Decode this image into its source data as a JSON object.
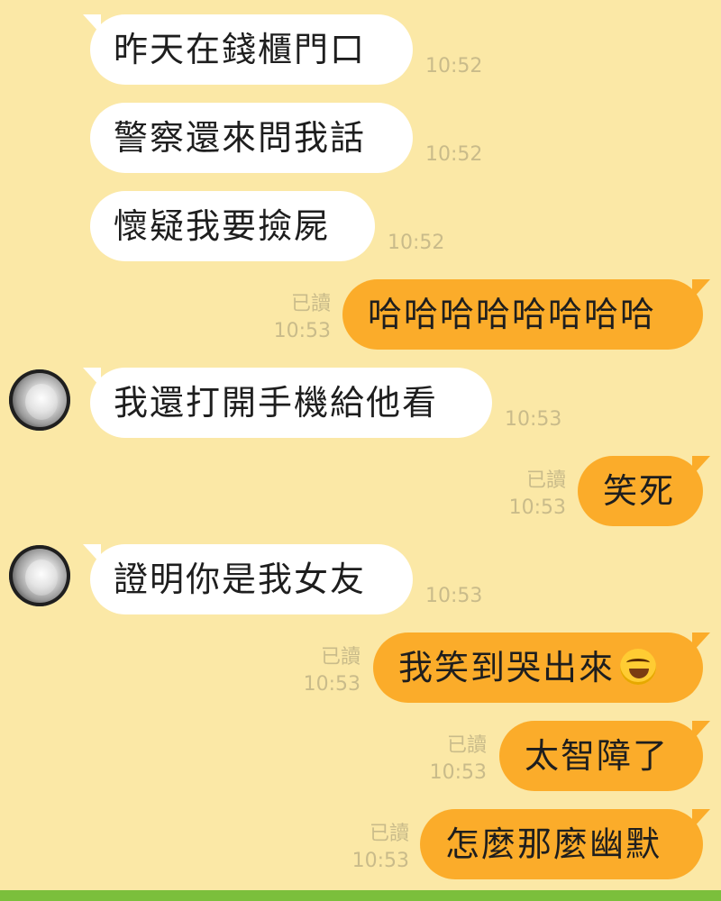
{
  "read_label": "已讀",
  "colors": {
    "background": "#fbe8a6",
    "incoming_bubble": "#ffffff",
    "outgoing_bubble": "#fbac2a",
    "bottom_bar": "#7bbf3c"
  },
  "messages": [
    {
      "side": "incoming",
      "text": "昨天在錢櫃門口",
      "time": "10:52"
    },
    {
      "side": "incoming",
      "text": "警察還來問我話",
      "time": "10:52"
    },
    {
      "side": "incoming",
      "text": "懷疑我要撿屍",
      "time": "10:52"
    },
    {
      "side": "outgoing",
      "text": "哈哈哈哈哈哈哈哈",
      "read": "已讀",
      "time": "10:53"
    },
    {
      "side": "incoming",
      "text": "我還打開手機給他看",
      "time": "10:53",
      "avatar": true
    },
    {
      "side": "outgoing",
      "text": "笑死",
      "read": "已讀",
      "time": "10:53"
    },
    {
      "side": "incoming",
      "text": "證明你是我女友",
      "time": "10:53",
      "avatar": true
    },
    {
      "side": "outgoing",
      "text": "我笑到哭出來",
      "read": "已讀",
      "time": "10:53",
      "emoji": "rolling-on-floor-laughing-emoji"
    },
    {
      "side": "outgoing",
      "text": "太智障了",
      "read": "已讀",
      "time": "10:53"
    },
    {
      "side": "outgoing",
      "text": "怎麼那麼幽默",
      "read": "已讀",
      "time": "10:53"
    }
  ]
}
